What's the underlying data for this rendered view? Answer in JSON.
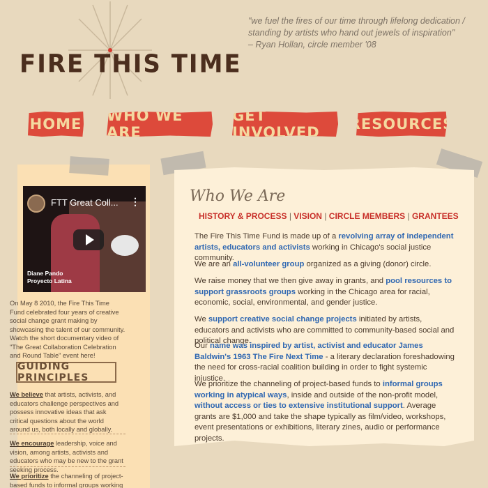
{
  "header": {
    "logo": "FIRE THIS TIME",
    "quote_line1": "\"we fuel the fires of our time through lifelong dedication /",
    "quote_line2": "standing by artists who hand out jewels of inspiration\"",
    "quote_attribution": "– Ryan Hollan, circle member '08"
  },
  "nav": {
    "home": "HOME",
    "who_we_are": "WHO WE ARE",
    "get_involved": "GET INVOLVED",
    "resources": "RESOURCES"
  },
  "sidebar": {
    "video_title": "FTT Great Coll...",
    "video_caption_line1": "Diane Pando",
    "video_caption_line2": "Proyecto Latina",
    "video_description": "On May 8 2010, the Fire This Time Fund celebrated four years of creative social change grant making by showcasing the talent of our community. Watch the short documentary video of \"The Great Collaboration Celebration and Round Table\" event here!",
    "principles_heading": "GUIDING PRINCIPLES",
    "principles": [
      {
        "lead": "We believe",
        "text": " that artists, activists, and educators challenge perspectives and possess innovative ideas that ask critical questions about the world around us, both locally and globally."
      },
      {
        "lead": "We encourage",
        "text": " leadership, voice and vision, among artists, activists and educators who may be new to the grant seeking process."
      },
      {
        "lead": "We prioritize",
        "text": " the channeling of project-based funds to informal groups working in"
      }
    ]
  },
  "main": {
    "title": "Who We Are",
    "subnav": [
      "HISTORY & PROCESS",
      "VISION",
      "CIRCLE MEMBERS",
      "GRANTEES"
    ],
    "p1": {
      "a": "The Fire This Time Fund is made up of a ",
      "b": "revolving array of independent artists, educators and activists",
      "c": " working in Chicago's social justice community."
    },
    "p2": {
      "a": "We are an ",
      "b": "all-volunteer group",
      "c": " organized as a giving (donor) circle."
    },
    "p3": {
      "a": "We raise money that we then give away in grants, and ",
      "b": "pool resources to support grassroots groups",
      "c": " working in the Chicago area for racial, economic, social, environmental, and gender justice."
    },
    "p4": {
      "a": "We ",
      "b": "support creative social change projects",
      "c": " initiated by artists, educators and activists who are committed to community-based social and political change."
    },
    "p5": {
      "a": "Our ",
      "b": "name was inspired by artist, activist and educator James Baldwin's 1963 The Fire Next Time",
      "c": " - a literary declaration foreshadowing the need for cross-racial coalition building in order to fight systemic injustice."
    },
    "p6": {
      "a": "We prioritize the channeling of project-based funds to ",
      "b": "informal groups working in atypical ways",
      "c": ", inside and outside of the non-profit model, ",
      "d": "without access or ties to extensive institutional support",
      "e": ". Average grants are $1,000 and take the shape typically as film/video, workshops, event presentations or exhibitions, literary zines, audio or performance projects."
    }
  },
  "colors": {
    "background": "#e8d9be",
    "nav_button": "#dd4a3b",
    "nav_text": "#f4d9a0",
    "link_blue": "#2f67b1",
    "subnav_red": "#c8302a"
  }
}
